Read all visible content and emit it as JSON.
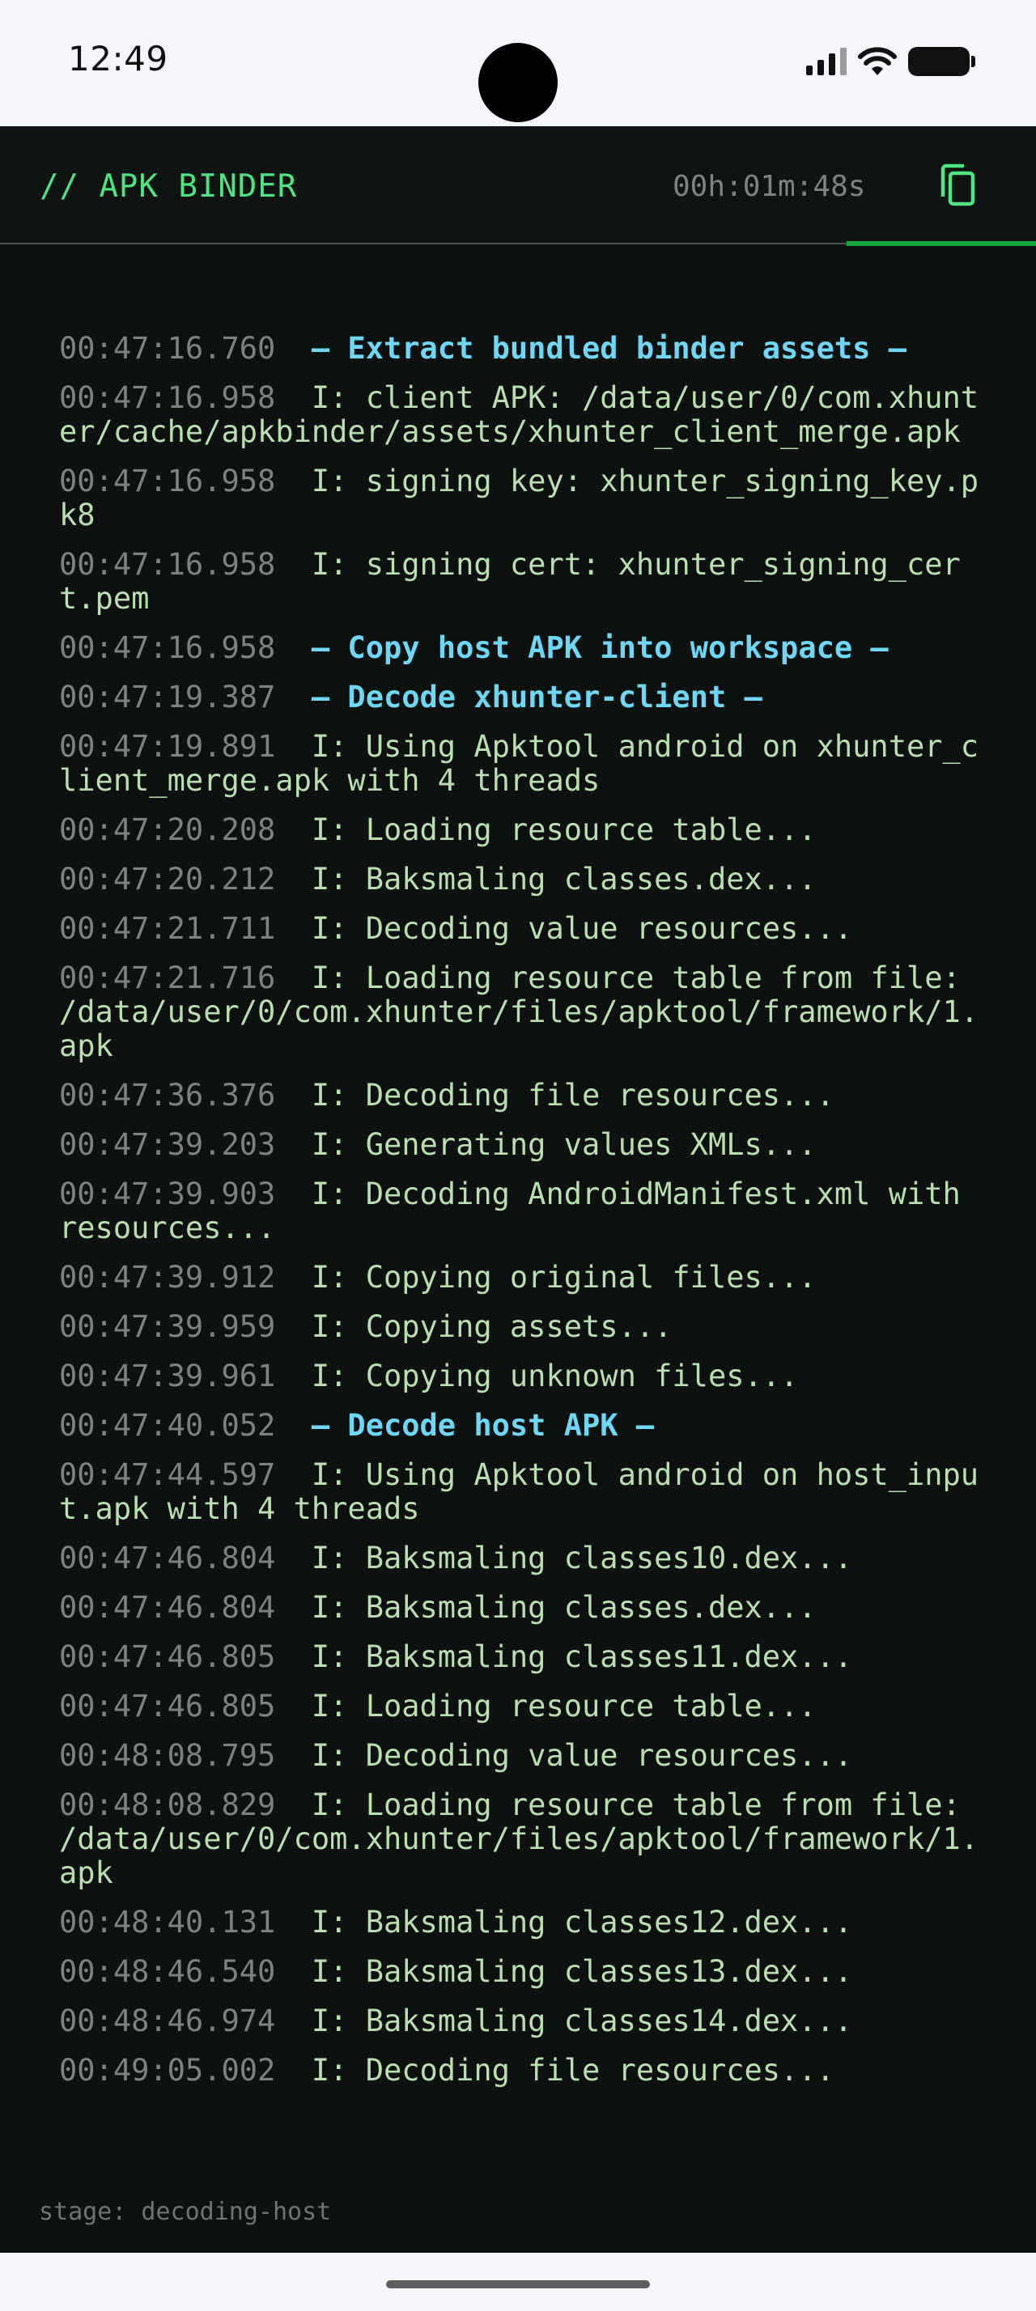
{
  "status_bar": {
    "time": "12:49",
    "icons": [
      "signal-icon",
      "wifi-icon",
      "battery-icon"
    ]
  },
  "header": {
    "title": "// APK BINDER",
    "timer": "00h:01m:48s",
    "copy_icon": "copy-icon"
  },
  "progress": {
    "fraction": 0.18,
    "color": "#19a53e"
  },
  "log": [
    {
      "ts": "00:47:16.760",
      "text": "— Extract bundled binder assets —",
      "kind": "section"
    },
    {
      "ts": "00:47:16.958",
      "text": "I: client APK: /data/user/0/com.xhunter/cache/apkbinder/assets/xhunter_client_merge.apk",
      "kind": "info"
    },
    {
      "ts": "00:47:16.958",
      "text": "I: signing key: xhunter_signing_key.pk8",
      "kind": "info"
    },
    {
      "ts": "00:47:16.958",
      "text": "I: signing cert: xhunter_signing_cert.pem",
      "kind": "info"
    },
    {
      "ts": "00:47:16.958",
      "text": "— Copy host APK into workspace —",
      "kind": "section"
    },
    {
      "ts": "00:47:19.387",
      "text": "— Decode xhunter-client —",
      "kind": "section"
    },
    {
      "ts": "00:47:19.891",
      "text": "I: Using Apktool android on xhunter_client_merge.apk with 4 threads",
      "kind": "info"
    },
    {
      "ts": "00:47:20.208",
      "text": "I: Loading resource table...",
      "kind": "info"
    },
    {
      "ts": "00:47:20.212",
      "text": "I: Baksmaling classes.dex...",
      "kind": "info"
    },
    {
      "ts": "00:47:21.711",
      "text": "I: Decoding value resources...",
      "kind": "info"
    },
    {
      "ts": "00:47:21.716",
      "text": "I: Loading resource table from file: /data/user/0/com.xhunter/files/apktool/framework/1.apk",
      "kind": "info"
    },
    {
      "ts": "00:47:36.376",
      "text": "I: Decoding file resources...",
      "kind": "info"
    },
    {
      "ts": "00:47:39.203",
      "text": "I: Generating values XMLs...",
      "kind": "info"
    },
    {
      "ts": "00:47:39.903",
      "text": "I: Decoding AndroidManifest.xml with resources...",
      "kind": "info"
    },
    {
      "ts": "00:47:39.912",
      "text": "I: Copying original files...",
      "kind": "info"
    },
    {
      "ts": "00:47:39.959",
      "text": "I: Copying assets...",
      "kind": "info"
    },
    {
      "ts": "00:47:39.961",
      "text": "I: Copying unknown files...",
      "kind": "info"
    },
    {
      "ts": "00:47:40.052",
      "text": "— Decode host APK —",
      "kind": "section"
    },
    {
      "ts": "00:47:44.597",
      "text": "I: Using Apktool android on host_input.apk with 4 threads",
      "kind": "info"
    },
    {
      "ts": "00:47:46.804",
      "text": "I: Baksmaling classes10.dex...",
      "kind": "info"
    },
    {
      "ts": "00:47:46.804",
      "text": "I: Baksmaling classes.dex...",
      "kind": "info"
    },
    {
      "ts": "00:47:46.805",
      "text": "I: Baksmaling classes11.dex...",
      "kind": "info"
    },
    {
      "ts": "00:47:46.805",
      "text": "I: Loading resource table...",
      "kind": "info"
    },
    {
      "ts": "00:48:08.795",
      "text": "I: Decoding value resources...",
      "kind": "info"
    },
    {
      "ts": "00:48:08.829",
      "text": "I: Loading resource table from file: /data/user/0/com.xhunter/files/apktool/framework/1.apk",
      "kind": "info"
    },
    {
      "ts": "00:48:40.131",
      "text": "I: Baksmaling classes12.dex...",
      "kind": "info"
    },
    {
      "ts": "00:48:46.540",
      "text": "I: Baksmaling classes13.dex...",
      "kind": "info"
    },
    {
      "ts": "00:48:46.974",
      "text": "I: Baksmaling classes14.dex...",
      "kind": "info"
    },
    {
      "ts": "00:49:05.002",
      "text": "I: Decoding file resources...",
      "kind": "info"
    }
  ],
  "footer": {
    "stage": "stage: decoding-host"
  }
}
